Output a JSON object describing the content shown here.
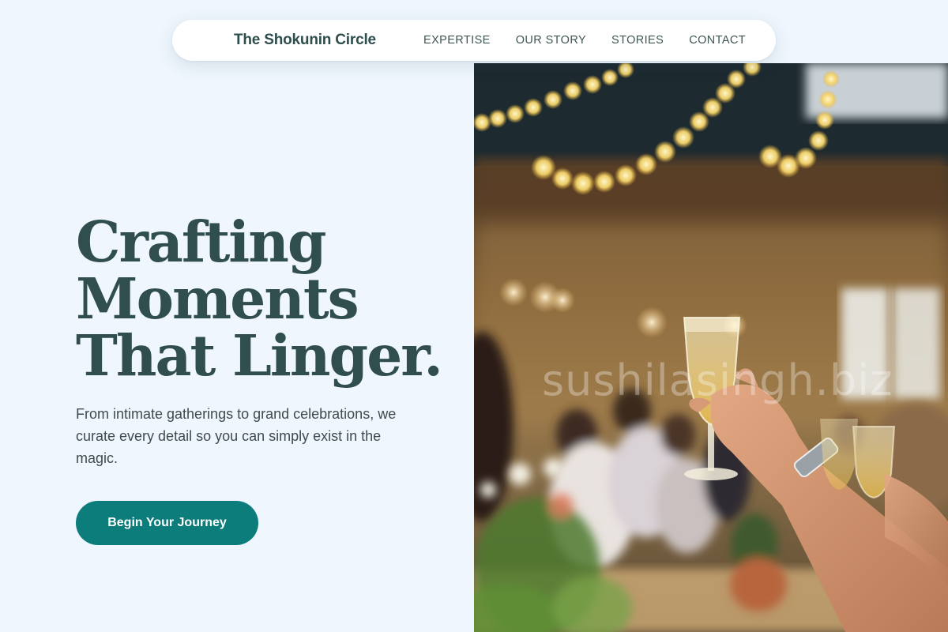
{
  "nav": {
    "brand": "The Shokunin Circle",
    "links": [
      {
        "label": "EXPERTISE"
      },
      {
        "label": "OUR STORY"
      },
      {
        "label": "STORIES"
      },
      {
        "label": "CONTACT"
      }
    ]
  },
  "hero": {
    "title_lines": [
      "Crafting",
      "Moments",
      "That Linger."
    ],
    "subtitle": "From intimate gatherings to grand celebrations, we curate every detail so you can simply exist in the magic.",
    "cta_label": "Begin Your Journey",
    "image_watermark": "sushilasingh.biz"
  },
  "colors": {
    "page_background": "#eff6fd",
    "heading": "#2f4e4d",
    "body_text": "#3f4b4d",
    "accent": "#0d7d7b",
    "nav_background": "#ffffff"
  },
  "icons": []
}
